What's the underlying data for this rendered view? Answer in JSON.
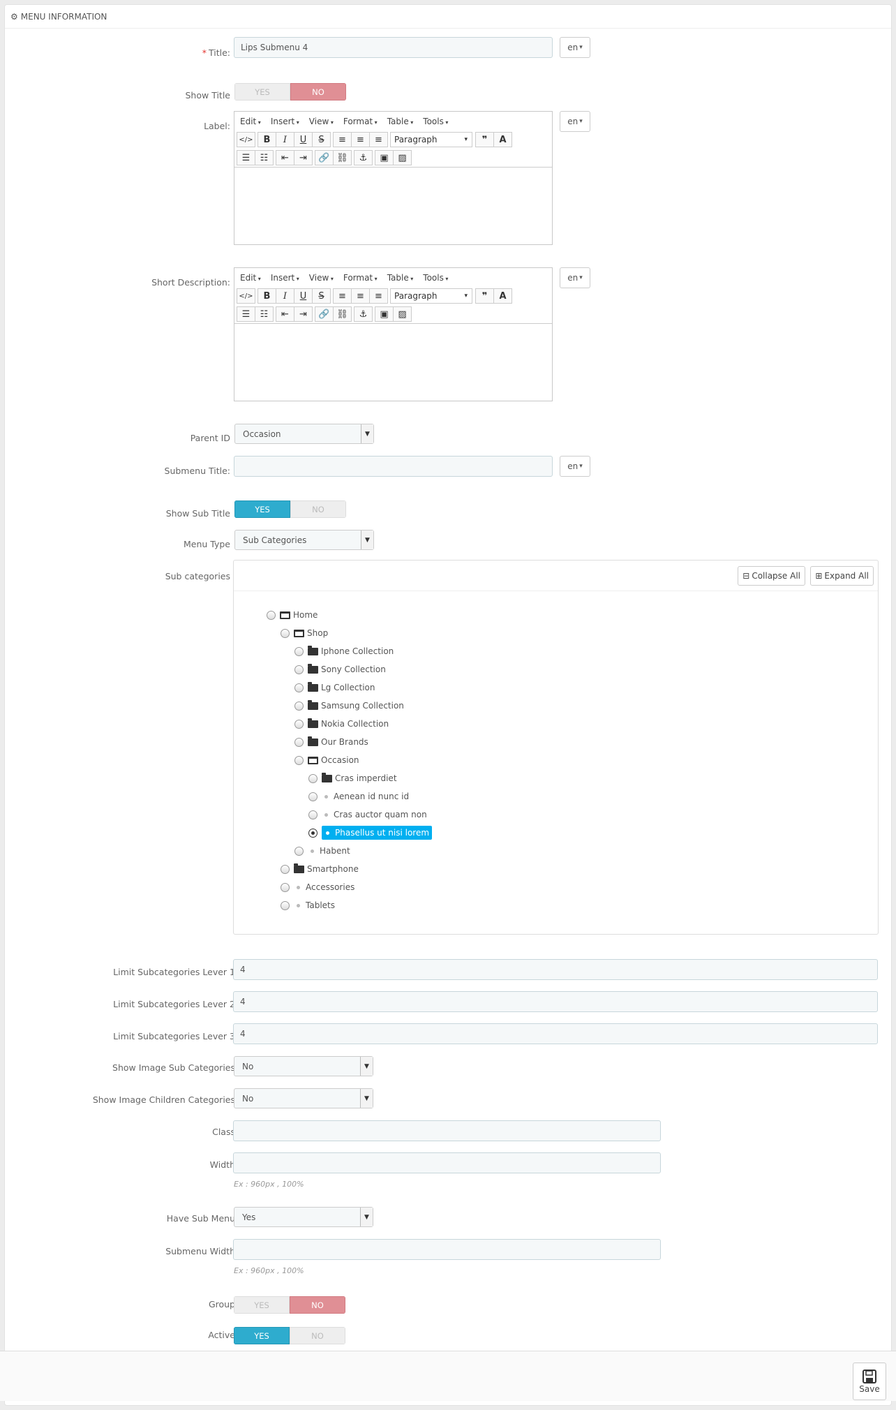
{
  "panel": {
    "title": "MENU INFORMATION"
  },
  "labels": {
    "title": "Title:",
    "show_title": "Show Title",
    "label": "Label:",
    "short_description": "Short Description:",
    "parent_id": "Parent ID",
    "submenu_title": "Submenu Title:",
    "show_sub_title": "Show Sub Title",
    "menu_type": "Menu Type",
    "sub_categories": "Sub categories",
    "limit1": "Limit Subcategories Lever 1",
    "limit2": "Limit Subcategories Lever 2",
    "limit3": "Limit Subcategories Lever 3",
    "show_image_sub": "Show Image Sub Categories",
    "show_image_children": "Show Image Children Categories",
    "class": "Class",
    "width": "Width",
    "have_sub_menu": "Have Sub Menu",
    "submenu_width": "Submenu Width",
    "group": "Group",
    "active": "Active"
  },
  "required_mark": "*",
  "fields": {
    "title_value": "Lips Submenu 4",
    "lang": "en",
    "parent_id": "Occasion",
    "submenu_title": "",
    "menu_type": "Sub Categories",
    "limit1": "4",
    "limit2": "4",
    "limit3": "4",
    "show_image_sub": "No",
    "show_image_children": "No",
    "class": "",
    "width": "",
    "width_hint": "Ex : 960px , 100%",
    "have_sub_menu": "Yes",
    "submenu_width": "",
    "submenu_width_hint": "Ex : 960px , 100%"
  },
  "switch": {
    "yes": "YES",
    "no": "NO"
  },
  "toggles": {
    "show_title": "no",
    "show_sub_title": "yes",
    "group": "no",
    "active": "yes"
  },
  "editor": {
    "menus": [
      "Edit",
      "Insert",
      "View",
      "Format",
      "Table",
      "Tools"
    ],
    "paragraph": "Paragraph"
  },
  "tree": {
    "collapse_all": "Collapse All",
    "expand_all": "Expand All",
    "nodes": [
      {
        "label": "Home",
        "icon": "folder-open",
        "level": 0
      },
      {
        "label": "Shop",
        "icon": "folder-open",
        "level": 1
      },
      {
        "label": "Iphone Collection",
        "icon": "folder",
        "level": 2
      },
      {
        "label": "Sony Collection",
        "icon": "folder",
        "level": 2
      },
      {
        "label": "Lg Collection",
        "icon": "folder",
        "level": 2
      },
      {
        "label": "Samsung Collection",
        "icon": "folder",
        "level": 2
      },
      {
        "label": "Nokia Collection",
        "icon": "folder",
        "level": 2
      },
      {
        "label": "Our Brands",
        "icon": "folder",
        "level": 2
      },
      {
        "label": "Occasion",
        "icon": "folder-open",
        "level": 2
      },
      {
        "label": "Cras imperdiet",
        "icon": "folder",
        "level": 3
      },
      {
        "label": "Aenean id nunc id",
        "icon": "dot",
        "level": 3
      },
      {
        "label": "Cras auctor quam non",
        "icon": "dot",
        "level": 3
      },
      {
        "label": "Phasellus ut nisi lorem",
        "icon": "dot",
        "level": 3,
        "selected": true
      },
      {
        "label": "Habent",
        "icon": "dot",
        "level": 2
      },
      {
        "label": "Smartphone",
        "icon": "folder",
        "level": 1
      },
      {
        "label": "Accessories",
        "icon": "dot",
        "level": 1
      },
      {
        "label": "Tablets",
        "icon": "dot",
        "level": 1
      }
    ]
  },
  "footer": {
    "save": "Save"
  }
}
